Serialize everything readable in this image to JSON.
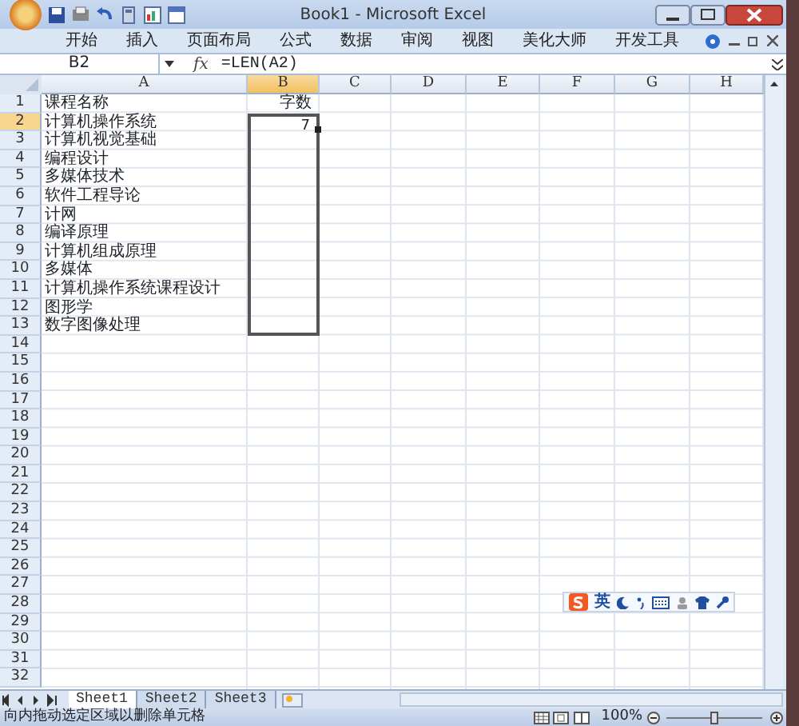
{
  "window": {
    "title": "Book1 - Microsoft Excel"
  },
  "ribbon_tabs": [
    "开始",
    "插入",
    "页面布局",
    "公式",
    "数据",
    "审阅",
    "视图",
    "美化大师",
    "开发工具"
  ],
  "formula_bar": {
    "name_box": "B2",
    "fx": "fx",
    "formula": "=LEN(A2)"
  },
  "columns": [
    {
      "label": "A",
      "selected": false
    },
    {
      "label": "B",
      "selected": true
    },
    {
      "label": "C",
      "selected": false
    },
    {
      "label": "D",
      "selected": false
    },
    {
      "label": "E",
      "selected": false
    },
    {
      "label": "F",
      "selected": false
    },
    {
      "label": "G",
      "selected": false
    },
    {
      "label": "H",
      "selected": false
    }
  ],
  "rows": [
    {
      "number": "1",
      "selected": false,
      "a": "课程名称",
      "b": "字数",
      "active": false,
      "in_selection": false
    },
    {
      "number": "2",
      "selected": true,
      "a": "计算机操作系统",
      "b": "7",
      "active": true,
      "in_selection": true
    },
    {
      "number": "3",
      "selected": false,
      "a": "计算机视觉基础",
      "active": false,
      "in_selection": true
    },
    {
      "number": "4",
      "selected": false,
      "a": "编程设计",
      "active": false,
      "in_selection": true
    },
    {
      "number": "5",
      "selected": false,
      "a": "多媒体技术",
      "active": false,
      "in_selection": true
    },
    {
      "number": "6",
      "selected": false,
      "a": "软件工程导论",
      "active": false,
      "in_selection": true
    },
    {
      "number": "7",
      "selected": false,
      "a": "计网",
      "active": false,
      "in_selection": true
    },
    {
      "number": "8",
      "selected": false,
      "a": "编译原理",
      "active": false,
      "in_selection": true
    },
    {
      "number": "9",
      "selected": false,
      "a": "计算机组成原理",
      "active": false,
      "in_selection": true
    },
    {
      "number": "10",
      "selected": false,
      "a": "多媒体",
      "active": false,
      "in_selection": true
    },
    {
      "number": "11",
      "selected": false,
      "a": "计算机操作系统课程设计",
      "active": false,
      "in_selection": true
    },
    {
      "number": "12",
      "selected": false,
      "a": "图形学",
      "active": false,
      "in_selection": true
    },
    {
      "number": "13",
      "selected": false,
      "a": "数字图像处理",
      "active": false,
      "in_selection": true
    },
    {
      "number": "14",
      "selected": false,
      "active": false,
      "in_selection": false
    },
    {
      "number": "15",
      "selected": false,
      "active": false,
      "in_selection": false
    },
    {
      "number": "16",
      "selected": false,
      "active": false,
      "in_selection": false
    },
    {
      "number": "17",
      "selected": false,
      "active": false,
      "in_selection": false
    },
    {
      "number": "18",
      "selected": false,
      "active": false,
      "in_selection": false
    },
    {
      "number": "19",
      "selected": false,
      "active": false,
      "in_selection": false
    },
    {
      "number": "20",
      "selected": false,
      "active": false,
      "in_selection": false
    },
    {
      "number": "21",
      "selected": false,
      "active": false,
      "in_selection": false
    },
    {
      "number": "22",
      "selected": false,
      "active": false,
      "in_selection": false
    },
    {
      "number": "23",
      "selected": false,
      "active": false,
      "in_selection": false
    },
    {
      "number": "24",
      "selected": false,
      "active": false,
      "in_selection": false
    },
    {
      "number": "25",
      "selected": false,
      "active": false,
      "in_selection": false
    },
    {
      "number": "26",
      "selected": false,
      "active": false,
      "in_selection": false
    },
    {
      "number": "27",
      "selected": false,
      "active": false,
      "in_selection": false
    },
    {
      "number": "28",
      "selected": false,
      "active": false,
      "in_selection": false
    },
    {
      "number": "29",
      "selected": false,
      "active": false,
      "in_selection": false
    },
    {
      "number": "30",
      "selected": false,
      "active": false,
      "in_selection": false
    },
    {
      "number": "31",
      "selected": false,
      "active": false,
      "in_selection": false
    },
    {
      "number": "32",
      "selected": false,
      "active": false,
      "in_selection": false
    }
  ],
  "sheet_tabs": [
    {
      "label": "Sheet1",
      "selected": true
    },
    {
      "label": "Sheet2",
      "selected": false
    },
    {
      "label": "Sheet3",
      "selected": false
    }
  ],
  "ime_toolbar": {
    "label": "英"
  },
  "status_bar": {
    "text": "向内拖动选定区域以删除单元格",
    "zoom": "100%",
    "zoom_slider": {
      "level": 0.5
    }
  }
}
